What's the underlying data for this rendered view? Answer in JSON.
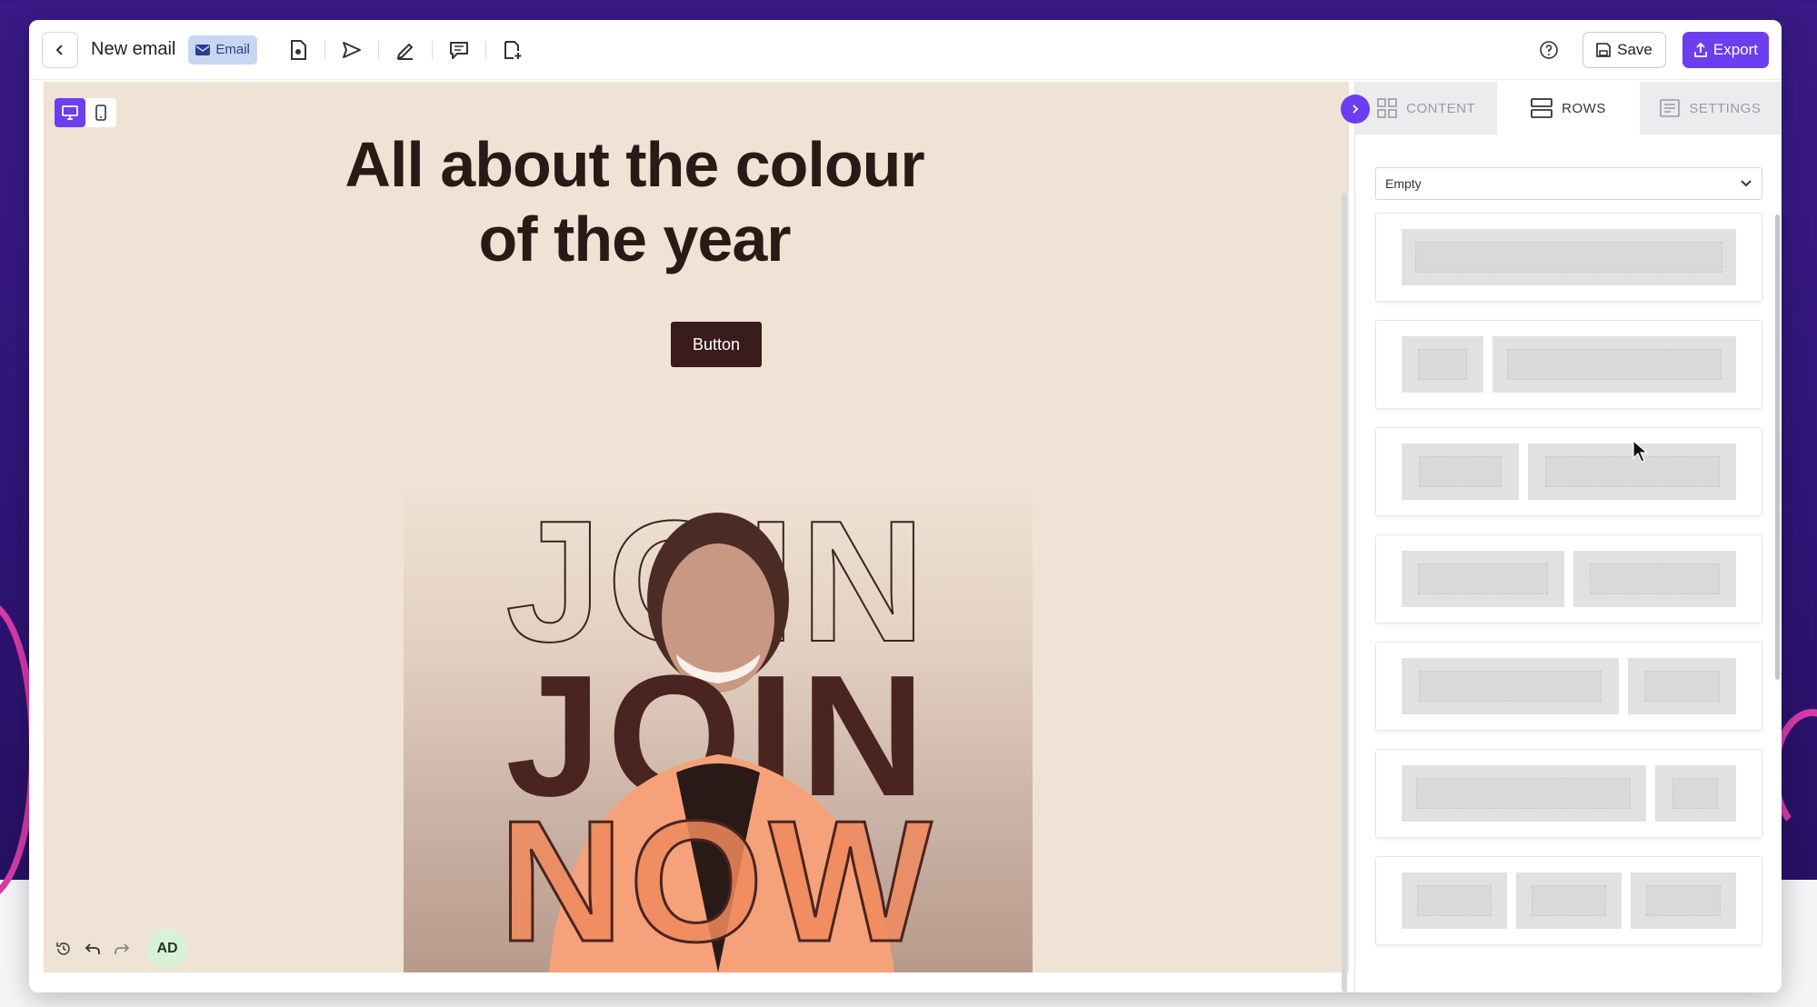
{
  "toolbar": {
    "title": "New email",
    "badge": "Email",
    "save_label": "Save",
    "export_label": "Export"
  },
  "canvas": {
    "headline_line1": "All about the colour",
    "headline_line2": "of the year",
    "button_label": "Button",
    "hero_text": [
      "JOIN",
      "JOIN",
      "NOW"
    ],
    "avatar_initials": "AD"
  },
  "panel": {
    "tabs": [
      {
        "label": "CONTENT",
        "icon": "grid-icon",
        "active": false
      },
      {
        "label": "ROWS",
        "icon": "rows-icon",
        "active": true
      },
      {
        "label": "SETTINGS",
        "icon": "settings-icon",
        "active": false
      }
    ],
    "row_filter": "Empty"
  },
  "colors": {
    "accent": "#6d3df0",
    "canvas_bg": "#efe3d5",
    "headline": "#2a1a17",
    "button_bg": "#3a1c1c",
    "hero_orange": "#f08a5d"
  }
}
